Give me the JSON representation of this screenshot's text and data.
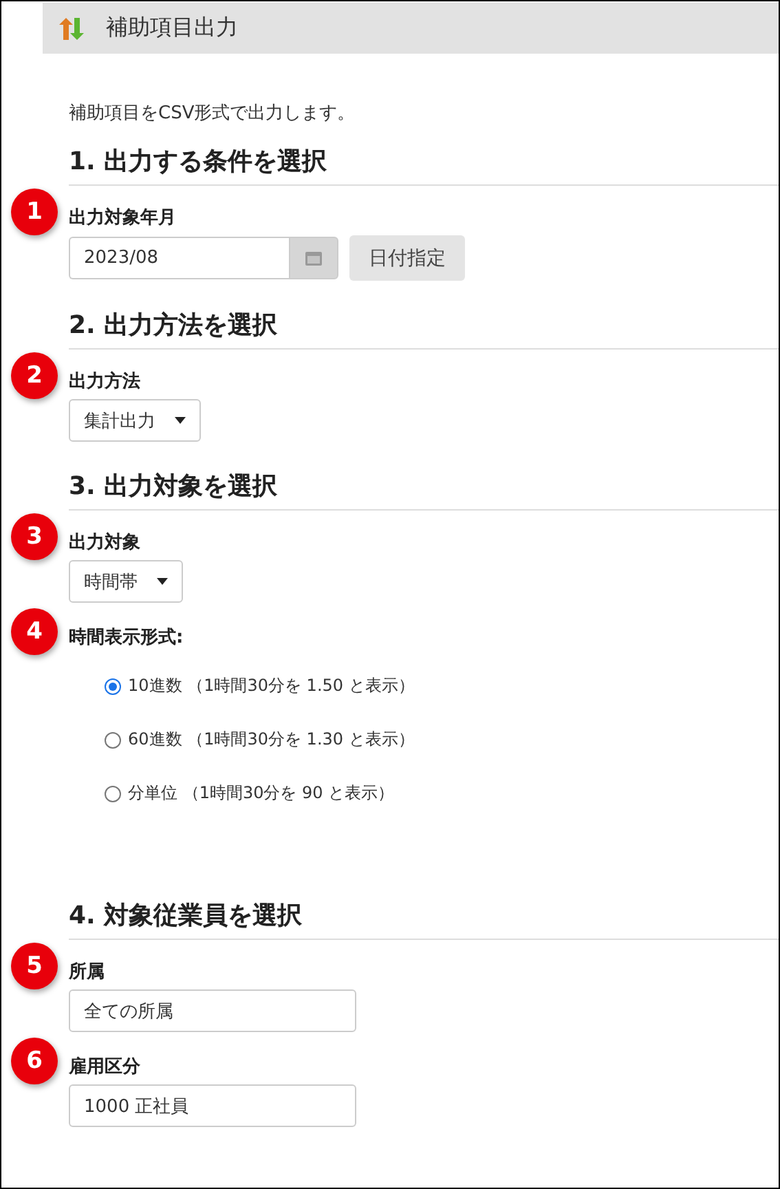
{
  "header": {
    "title": "補助項目出力"
  },
  "description": "補助項目をCSV形式で出力します。",
  "sections": [
    {
      "heading": "1. 出力する条件を選択",
      "fields": [
        {
          "kind": "date",
          "badge": "1",
          "label": "出力対象年月",
          "value": "2023/08",
          "button": "日付指定"
        }
      ]
    },
    {
      "heading": "2. 出力方法を選択",
      "fields": [
        {
          "kind": "select",
          "badge": "2",
          "label": "出力方法",
          "value": "集計出力"
        }
      ]
    },
    {
      "heading": "3. 出力対象を選択",
      "fields": [
        {
          "kind": "select",
          "badge": "3",
          "label": "出力対象",
          "value": "時間帯"
        },
        {
          "kind": "radio",
          "badge": "4",
          "label": "時間表示形式:",
          "options": [
            {
              "label": "10進数 （1時間30分を 1.50 と表示）",
              "selected": true
            },
            {
              "label": "60進数 （1時間30分を 1.30 と表示）",
              "selected": false
            },
            {
              "label": "分単位 （1時間30分を 90 と表示）",
              "selected": false
            }
          ]
        }
      ]
    },
    {
      "heading": "4. 対象従業員を選択",
      "fields": [
        {
          "kind": "text",
          "badge": "5",
          "label": "所属",
          "value": "全ての所属"
        },
        {
          "kind": "text",
          "badge": "6",
          "label": "雇用区分",
          "value": "1000 正社員"
        }
      ]
    }
  ]
}
